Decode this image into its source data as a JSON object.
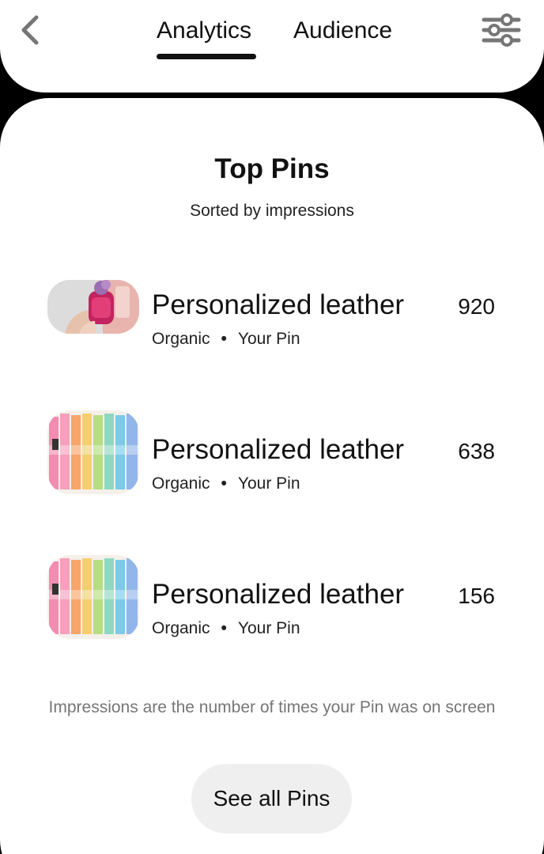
{
  "header": {
    "tabs": [
      {
        "label": "Analytics",
        "active": true
      },
      {
        "label": "Audience",
        "active": false
      }
    ],
    "icons": {
      "back": "chevron-left-icon",
      "filter": "sliders-icon"
    }
  },
  "top_pins": {
    "title": "Top Pins",
    "subtitle": "Sorted by impressions",
    "pins": [
      {
        "title": "Personalized leather",
        "source": "Organic",
        "owner": "Your Pin",
        "impressions": "920",
        "thumb": "hand-holding-keychain"
      },
      {
        "title": "Personalized leather",
        "source": "Organic",
        "owner": "Your Pin",
        "impressions": "638",
        "thumb": "rainbow-keychains"
      },
      {
        "title": "Personalized leather",
        "source": "Organic",
        "owner": "Your Pin",
        "impressions": "156",
        "thumb": "rainbow-keychains"
      }
    ],
    "footnote": "Impressions are the number of times your Pin was on screen",
    "see_all_label": "See all Pins"
  },
  "colors": {
    "background": "#000000",
    "card": "#ffffff",
    "text": "#111111",
    "muted": "#767676",
    "button": "#efefef"
  }
}
